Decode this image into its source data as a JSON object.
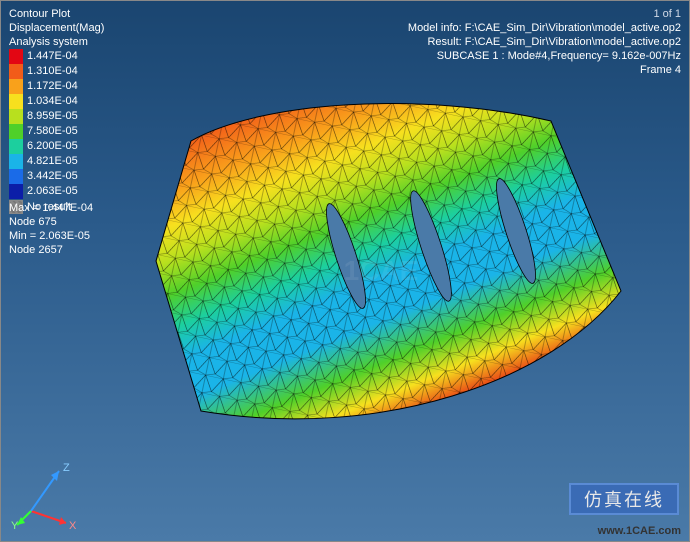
{
  "header_left": {
    "title": "Contour Plot",
    "quantity": "Displacement(Mag)",
    "system": "Analysis system"
  },
  "header_right": {
    "page_counter": "1 of 1",
    "model_info": "Model info: F:\\CAE_Sim_Dir\\Vibration\\model_active.op2",
    "result": "Result: F:\\CAE_Sim_Dir\\Vibration\\model_active.op2",
    "subcase": "SUBCASE 1 : Mode#4,Frequency= 9.162e-007Hz",
    "frame": "Frame 4"
  },
  "legend": {
    "values": [
      {
        "label": "1.447E-04",
        "color": "#e30613"
      },
      {
        "label": "1.310E-04",
        "color": "#f25c19"
      },
      {
        "label": "1.172E-04",
        "color": "#f9a11b"
      },
      {
        "label": "1.034E-04",
        "color": "#f7e01e"
      },
      {
        "label": "8.959E-05",
        "color": "#b8e01e"
      },
      {
        "label": "7.580E-05",
        "color": "#4fd02a"
      },
      {
        "label": "6.200E-05",
        "color": "#1ccf9e"
      },
      {
        "label": "4.821E-05",
        "color": "#1ab4e8"
      },
      {
        "label": "3.442E-05",
        "color": "#1a6be8"
      },
      {
        "label": "2.063E-05",
        "color": "#0b1ea8"
      }
    ],
    "no_result_label": "No result"
  },
  "stats": {
    "max_label": "Max = 1.447E-04",
    "max_node": "Node 675",
    "min_label": "Min = 2.063E-05",
    "min_node": "Node 2657"
  },
  "triad": {
    "x": "X",
    "y": "Y",
    "z": "Z"
  },
  "watermark_main": "www.1CAE.com",
  "watermark_faint": "1CAE",
  "banner_text": "仿真在线",
  "chart_data": {
    "type": "contour",
    "quantity": "Displacement (Mag)",
    "contour_levels": [
      2.063e-05,
      3.442e-05,
      4.821e-05,
      6.2e-05,
      7.58e-05,
      8.959e-05,
      0.0001034,
      0.0001172,
      0.000131,
      0.0001447
    ],
    "colormap": [
      "#0b1ea8",
      "#1a6be8",
      "#1ab4e8",
      "#1ccf9e",
      "#4fd02a",
      "#b8e01e",
      "#f7e01e",
      "#f9a11b",
      "#f25c19",
      "#e30613"
    ],
    "max": {
      "value": 0.0001447,
      "node": 675
    },
    "min": {
      "value": 2.063e-05,
      "node": 2657
    },
    "subcase": "SUBCASE 1",
    "mode": 4,
    "frequency_hz": 9.162e-07,
    "frame": 4
  }
}
